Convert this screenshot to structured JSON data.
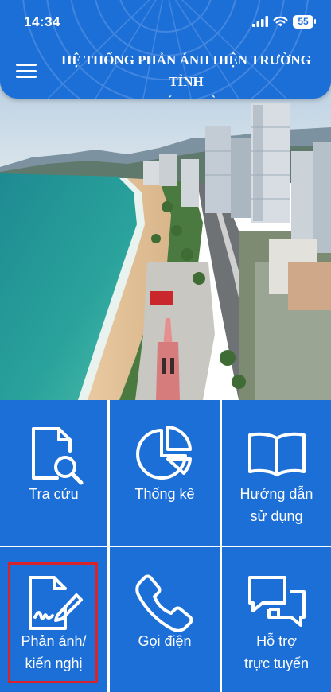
{
  "status_bar": {
    "time": "14:34",
    "battery": "55"
  },
  "header": {
    "title_line1": "HỆ THỐNG PHẢN ÁNH HIỆN TRƯỜNG TỈNH",
    "title_line2": "KHÁNH HÒA"
  },
  "tiles": [
    {
      "line1": "Tra cứu",
      "line2": "",
      "icon": "document-search-icon"
    },
    {
      "line1": "Thống kê",
      "line2": "",
      "icon": "pie-chart-icon"
    },
    {
      "line1": "Hướng dẫn",
      "line2": "sử dụng",
      "icon": "open-book-icon"
    },
    {
      "line1": "Phản ánh/",
      "line2": "kiến nghị",
      "icon": "document-edit-icon"
    },
    {
      "line1": "Gọi điện",
      "line2": "",
      "icon": "phone-icon"
    },
    {
      "line1": "Hỗ trợ",
      "line2": "trực tuyến",
      "icon": "chat-bubbles-icon"
    }
  ],
  "colors": {
    "primary": "#1d6fd8",
    "highlight": "#d7242a"
  }
}
